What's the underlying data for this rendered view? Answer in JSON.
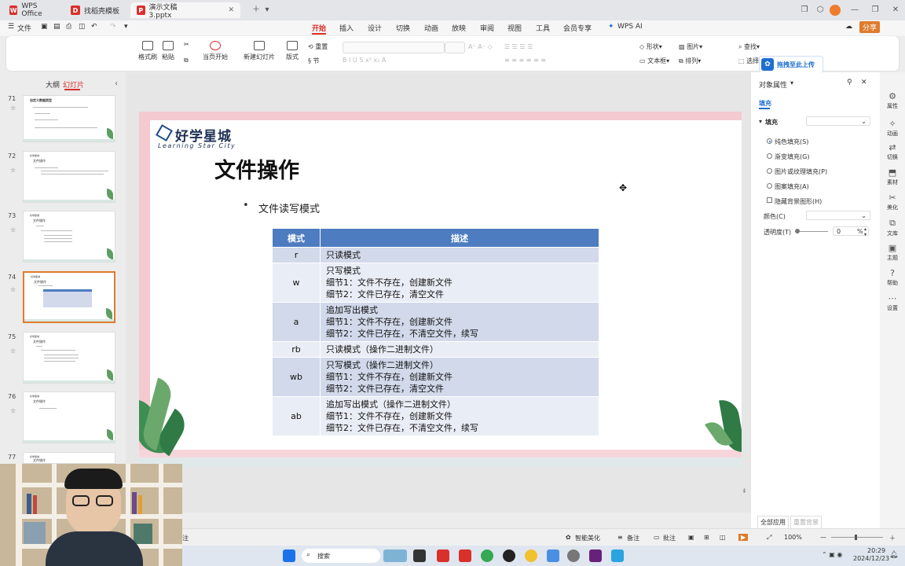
{
  "titlebar": {
    "tabs": [
      {
        "label": "WPS Office",
        "logo": "W",
        "color": "#d9302c"
      },
      {
        "label": "找稻壳模板",
        "logo": "D",
        "color": "#d9302c"
      },
      {
        "label": "演示文稿3.pptx",
        "logo": "P",
        "color": "#d9302c"
      }
    ],
    "avatar_color": "#f07b2c"
  },
  "menubar": {
    "file_label": "文件",
    "items": [
      "开始",
      "插入",
      "设计",
      "切换",
      "动画",
      "放映",
      "审阅",
      "视图",
      "工具",
      "会员专享"
    ],
    "ai_label": "WPS AI",
    "share_label": "分享"
  },
  "ribbon": {
    "format_painter": "格式刷",
    "paste": "粘贴",
    "play_from_start": "当页开始",
    "new_slide": "新建幻灯片",
    "layout": "版式",
    "reset": "重置",
    "section": "节",
    "shape": "形状",
    "picture": "图片",
    "find": "查找",
    "textbox": "文本框",
    "arrange": "排列",
    "select": "选择"
  },
  "upload": {
    "label": "拖拽至此上传"
  },
  "left_panel": {
    "tab_outline": "大纲",
    "tab_slides": "幻灯片",
    "slides": [
      {
        "num": "71",
        "title": "自定义数据类型"
      },
      {
        "num": "72",
        "title": "文件操作"
      },
      {
        "num": "73",
        "title": "文件操作"
      },
      {
        "num": "74",
        "title": "文件操作"
      },
      {
        "num": "75",
        "title": "文件操作"
      },
      {
        "num": "76",
        "title": "文件操作"
      },
      {
        "num": "77",
        "title": "文件操作"
      }
    ]
  },
  "slide": {
    "brand": "好学星城",
    "brand_en": "Learning Star City",
    "title": "文件操作",
    "bullet": "文件读写模式",
    "table": {
      "headers": [
        "模式",
        "描述"
      ],
      "rows": [
        {
          "mode": "r",
          "lines": [
            "只读模式"
          ]
        },
        {
          "mode": "w",
          "lines": [
            "只写模式",
            "细节1：文件不存在，创建新文件",
            "细节2：文件已存在，清空文件"
          ]
        },
        {
          "mode": "a",
          "lines": [
            "追加写出模式",
            "细节1：文件不存在，创建新文件",
            "细节2：文件已存在，不清空文件，续写"
          ]
        },
        {
          "mode": "rb",
          "lines": [
            "只读模式（操作二进制文件）"
          ]
        },
        {
          "mode": "wb",
          "lines": [
            "只写模式（操作二进制文件）",
            "细节1：文件不存在，创建新文件",
            "细节2：文件已存在，清空文件"
          ]
        },
        {
          "mode": "ab",
          "lines": [
            "追加写出模式（操作二进制文件）",
            "细节1：文件不存在，创建新文件",
            "细节2：文件已存在，不清空文件，续写"
          ]
        }
      ],
      "header_color": "#4e7cc0"
    }
  },
  "right_panel": {
    "title": "对象属性",
    "tab_fill": "填充",
    "fill_label": "填充",
    "options": [
      "纯色填充(S)",
      "渐变填充(G)",
      "图片或纹理填充(P)",
      "图案填充(A)"
    ],
    "hide_bg": "隐藏背景图形(H)",
    "color_label": "颜色(C)",
    "transparency_label": "透明度(T)",
    "transparency_value": "0",
    "transparency_unit": "%",
    "apply_all": "全部应用",
    "reset_bg": "重置背景"
  },
  "right_bar": [
    "属性",
    "动画",
    "切换",
    "素材",
    "美化",
    "文库",
    "主题",
    "帮助",
    "设置"
  ],
  "statusbar": {
    "notes_hint": "注",
    "beautify": "智能美化",
    "notes": "备注",
    "comments": "批注",
    "zoom": "100%"
  },
  "taskbar": {
    "search": "搜索",
    "time": "20:29",
    "date": "2024/12/23"
  }
}
